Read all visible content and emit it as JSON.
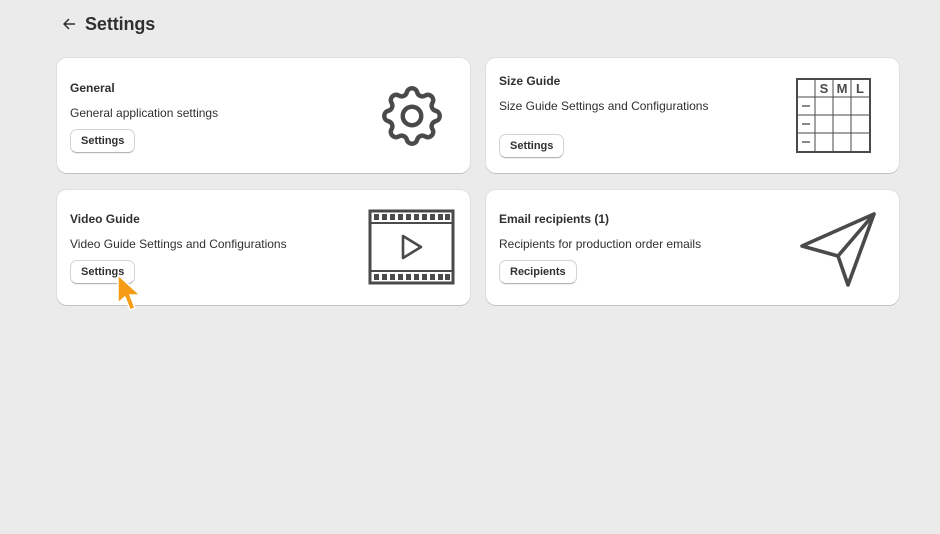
{
  "page": {
    "title": "Settings",
    "back_icon": "arrow-left-icon"
  },
  "cards": [
    {
      "title": "General",
      "description": "General application settings",
      "button_label": "Settings",
      "icon": "gear-icon"
    },
    {
      "title": "Size Guide",
      "description": "Size Guide Settings and Configurations",
      "button_label": "Settings",
      "icon": "size-table-icon",
      "size_labels": [
        "S",
        "M",
        "L"
      ]
    },
    {
      "title": "Video Guide",
      "description": "Video Guide Settings and Configurations",
      "button_label": "Settings",
      "icon": "film-play-icon"
    },
    {
      "title": "Email recipients (1)",
      "description": "Recipients for production order emails",
      "button_label": "Recipients",
      "icon": "paper-plane-icon"
    }
  ],
  "colors": {
    "background": "#ebebeb",
    "card": "#ffffff",
    "text": "#303030",
    "icon_stroke": "#4a4a4a",
    "cursor": "#f59b14"
  }
}
